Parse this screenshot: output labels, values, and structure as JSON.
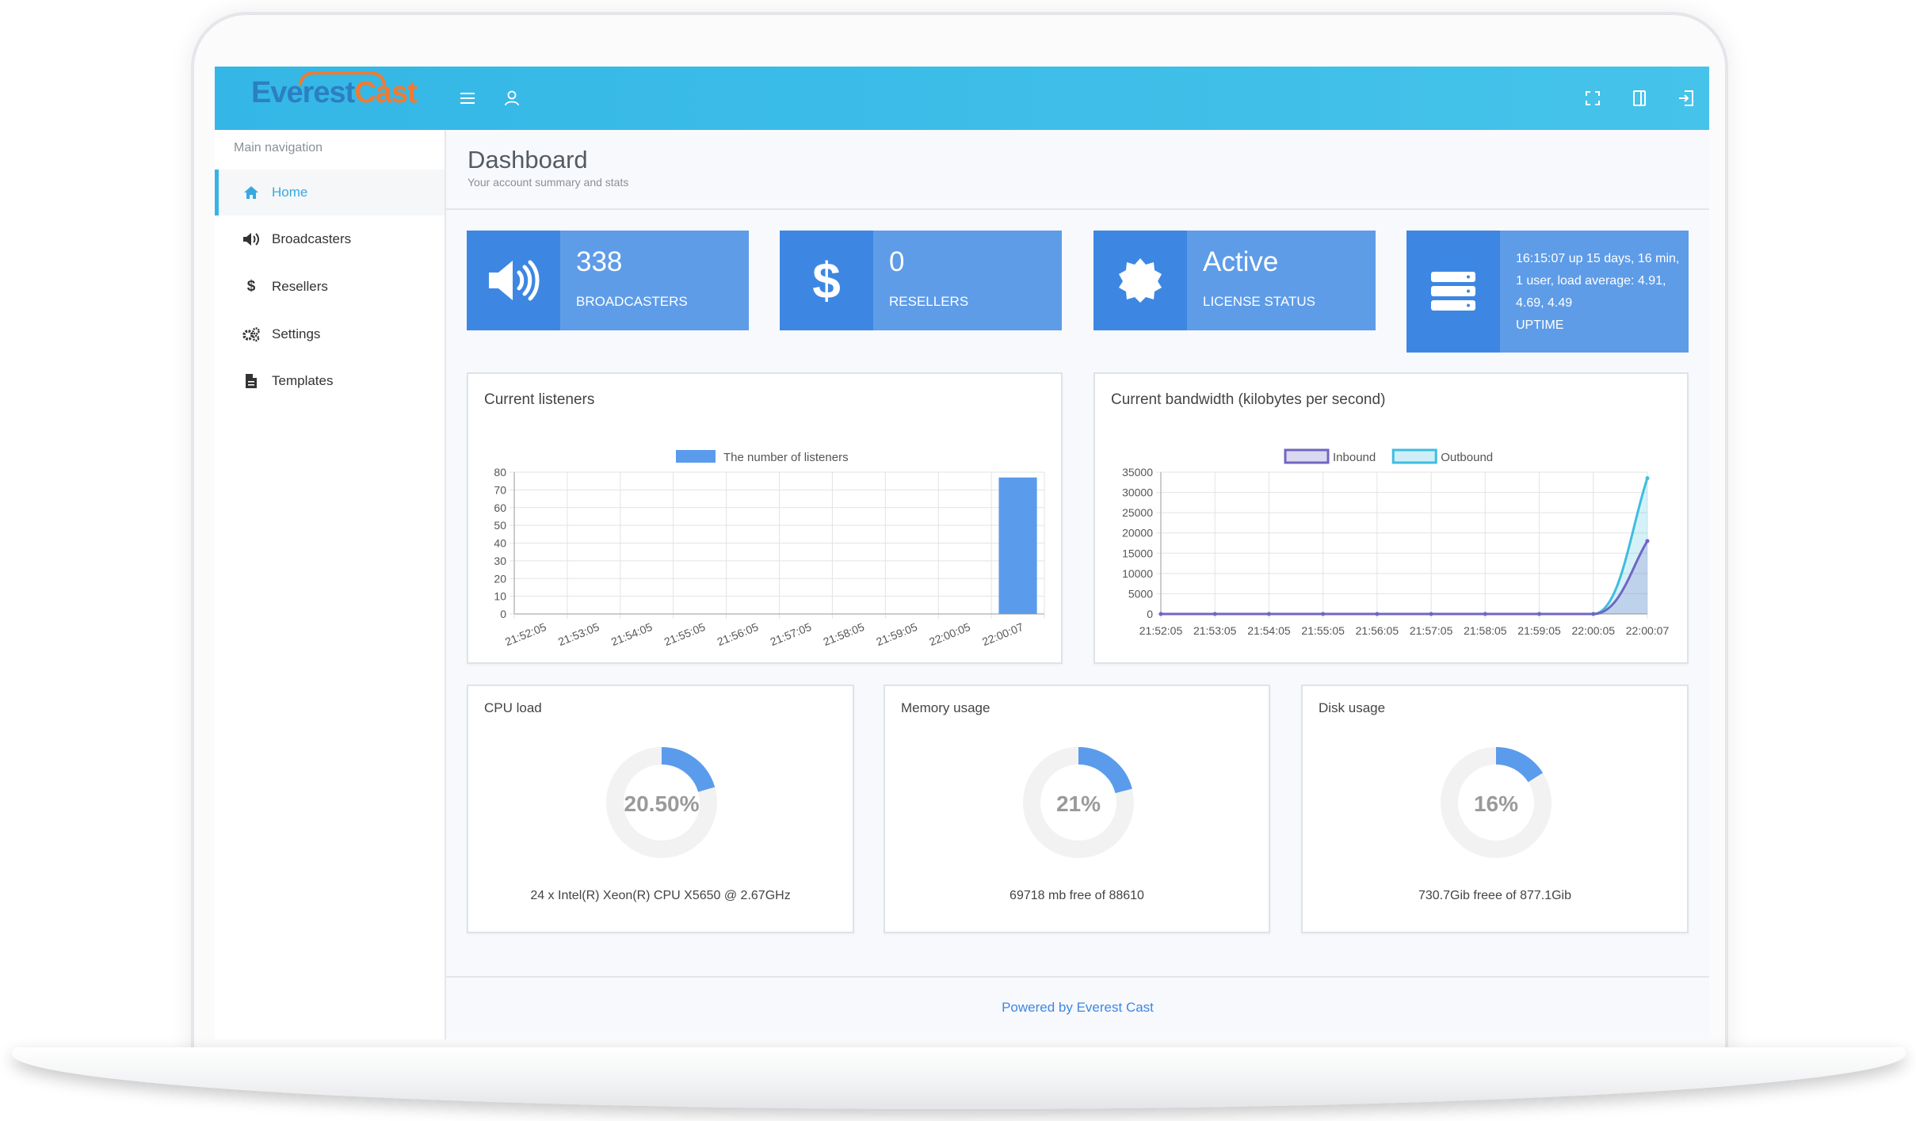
{
  "app": {
    "logo_main": "Everest",
    "logo_accent": "Cast"
  },
  "topbar": {
    "menu_icon": "hamburger-icon",
    "user_icon": "user-icon",
    "fullscreen_icon": "fullscreen-icon",
    "panel_icon": "panel-toggle-icon",
    "logout_icon": "logout-icon"
  },
  "sidebar": {
    "title": "Main navigation",
    "items": [
      {
        "label": "Home",
        "icon": "home-icon",
        "active": true
      },
      {
        "label": "Broadcasters",
        "icon": "volume-icon"
      },
      {
        "label": "Resellers",
        "icon": "dollar-icon"
      },
      {
        "label": "Settings",
        "icon": "gears-icon"
      },
      {
        "label": "Templates",
        "icon": "file-icon"
      }
    ]
  },
  "page": {
    "title": "Dashboard",
    "subtitle": "Your account summary and stats"
  },
  "stats": [
    {
      "value": "338",
      "label": "BROADCASTERS",
      "icon": "volume-icon"
    },
    {
      "value": "0",
      "label": "RESELLERS",
      "icon": "dollar-icon"
    },
    {
      "value": "Active",
      "label": "LICENSE STATUS",
      "icon": "badge-icon"
    },
    {
      "value": "16:15:07 up 15 days, 16 min, 1 user, load average: 4.91, 4.69, 4.49",
      "label": "UPTIME",
      "icon": "server-icon"
    }
  ],
  "panels": {
    "listeners_title": "Current listeners",
    "bandwidth_title": "Current bandwidth (kilobytes per second)",
    "cpu": {
      "title": "CPU load",
      "value_text": "20.50%",
      "fraction": 0.205,
      "detail": "24 x Intel(R) Xeon(R) CPU X5650 @ 2.67GHz"
    },
    "memory": {
      "title": "Memory usage",
      "value_text": "21%",
      "fraction": 0.21,
      "detail": "69718 mb free of 88610"
    },
    "disk": {
      "title": "Disk usage",
      "value_text": "16%",
      "fraction": 0.16,
      "detail": "730.7Gib freee of 877.1Gib"
    }
  },
  "chart_data": [
    {
      "type": "bar",
      "legend": [
        "The number of listeners"
      ],
      "categories": [
        "21:52:05",
        "21:53:05",
        "21:54:05",
        "21:55:05",
        "21:56:05",
        "21:57:05",
        "21:58:05",
        "21:59:05",
        "22:00:05",
        "22:00:07"
      ],
      "series": [
        {
          "name": "The number of listeners",
          "values": [
            0,
            0,
            0,
            0,
            0,
            0,
            0,
            0,
            0,
            77
          ]
        }
      ],
      "ylim": [
        0,
        80
      ],
      "yticks": [
        0,
        10,
        20,
        30,
        40,
        50,
        60,
        70,
        80
      ],
      "grid": true,
      "legend_position": "top",
      "colors": {
        "bar": "#5b9bec"
      }
    },
    {
      "type": "line",
      "categories": [
        "21:52:05",
        "21:53:05",
        "21:54:05",
        "21:55:05",
        "21:56:05",
        "21:57:05",
        "21:58:05",
        "21:59:05",
        "22:00:05",
        "22:00:07"
      ],
      "series": [
        {
          "name": "Inbound",
          "values": [
            0,
            0,
            0,
            0,
            0,
            0,
            0,
            0,
            0,
            18000
          ],
          "color": "#7066c2"
        },
        {
          "name": "Outbound",
          "values": [
            0,
            0,
            0,
            0,
            0,
            0,
            0,
            0,
            0,
            33500
          ],
          "color": "#3ebde0"
        }
      ],
      "ylim": [
        0,
        35000
      ],
      "yticks": [
        0,
        5000,
        10000,
        15000,
        20000,
        25000,
        30000,
        35000
      ],
      "grid": true,
      "legend_position": "top"
    }
  ],
  "footer": {
    "text": "Powered by Everest Cast"
  }
}
